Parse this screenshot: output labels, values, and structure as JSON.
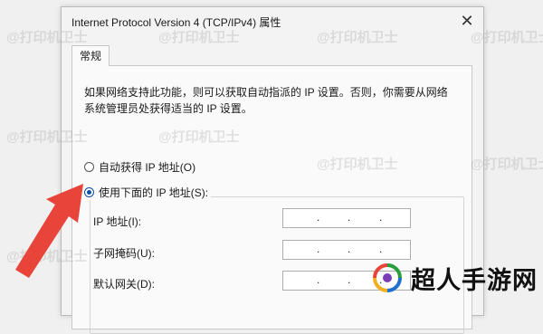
{
  "dialog": {
    "title": "Internet Protocol Version 4 (TCP/IPv4) 属性",
    "close_glyph": "✕"
  },
  "tabs": [
    {
      "label": "常规"
    }
  ],
  "general": {
    "description": "如果网络支持此功能，则可以获取自动指派的 IP 设置。否则，你需要从网络系统管理员处获得适当的 IP 设置。",
    "radio_auto": {
      "label": "自动获得 IP 地址(O)",
      "checked": false
    },
    "radio_manual": {
      "label": "使用下面的 IP 地址(S):",
      "checked": true
    },
    "fields": [
      {
        "label": "IP 地址(I):",
        "value": ""
      },
      {
        "label": "子网掩码(U):",
        "value": ""
      },
      {
        "label": "默认网关(D):",
        "value": ""
      }
    ]
  },
  "watermark": {
    "text": "@打印机卫士"
  },
  "logo": {
    "text": "超人手游网"
  },
  "colors": {
    "accent": "#0a4ea3",
    "arrow": "#e8443a"
  },
  "icons": {
    "close": "close-icon",
    "arrow": "pointer-arrow-icon",
    "logo": "brand-logo-icon"
  }
}
